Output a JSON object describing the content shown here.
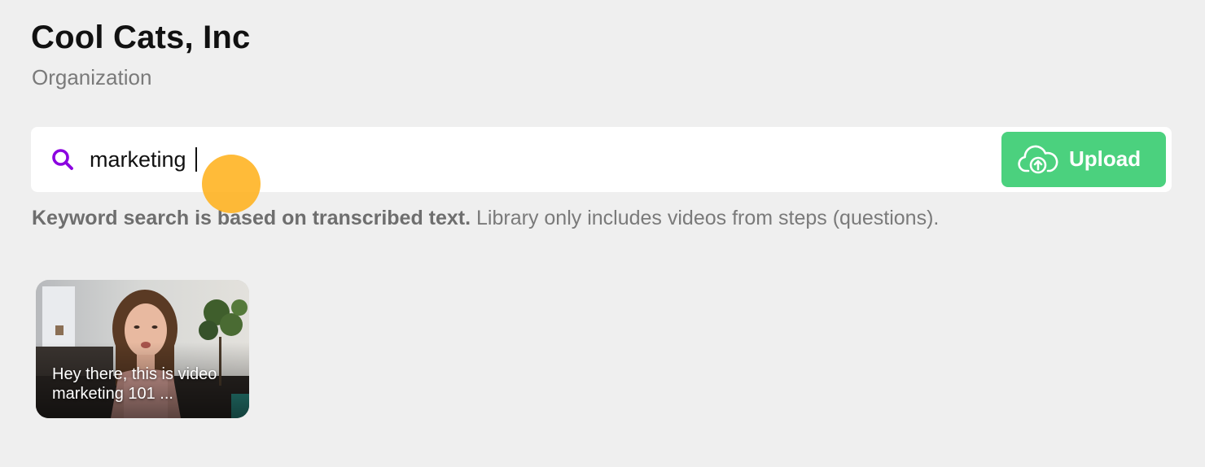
{
  "header": {
    "title": "Cool Cats, Inc",
    "subtitle": "Organization"
  },
  "search": {
    "value": "marketing",
    "icon": "search-icon",
    "icon_color": "#8b00e0"
  },
  "upload": {
    "label": "Upload",
    "icon": "cloud-upload-icon",
    "color": "#4bd17e"
  },
  "help": {
    "bold": "Keyword search is based on transcribed text.",
    "normal": " Library only includes videos from steps (questions)."
  },
  "videos": [
    {
      "caption": "Hey there, this is video marketing 101 ..."
    }
  ]
}
